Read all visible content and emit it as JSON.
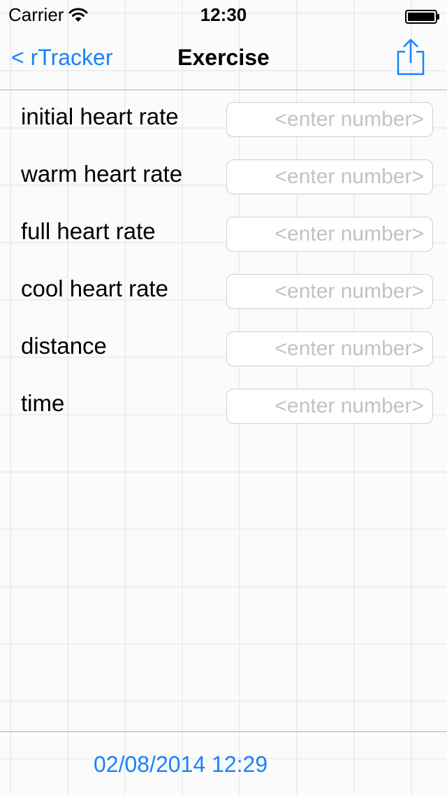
{
  "status_bar": {
    "carrier": "Carrier",
    "time": "12:30",
    "wifi_icon": "wifi-icon",
    "battery_icon": "battery-icon"
  },
  "nav": {
    "back_label": "< rTracker",
    "title": "Exercise",
    "share_icon": "share-icon",
    "accent_color": "#1a82fb"
  },
  "fields": [
    {
      "label": "initial heart rate",
      "value": "",
      "placeholder": "<enter number>"
    },
    {
      "label": "warm heart rate",
      "value": "",
      "placeholder": "<enter number>"
    },
    {
      "label": "full heart rate",
      "value": "",
      "placeholder": "<enter number>"
    },
    {
      "label": "cool heart rate",
      "value": "",
      "placeholder": "<enter number>"
    },
    {
      "label": "distance",
      "value": "",
      "placeholder": "<enter number>"
    },
    {
      "label": "time",
      "value": "",
      "placeholder": "<enter number>"
    }
  ],
  "toolbar": {
    "date_label": "02/08/2014 12:29"
  }
}
